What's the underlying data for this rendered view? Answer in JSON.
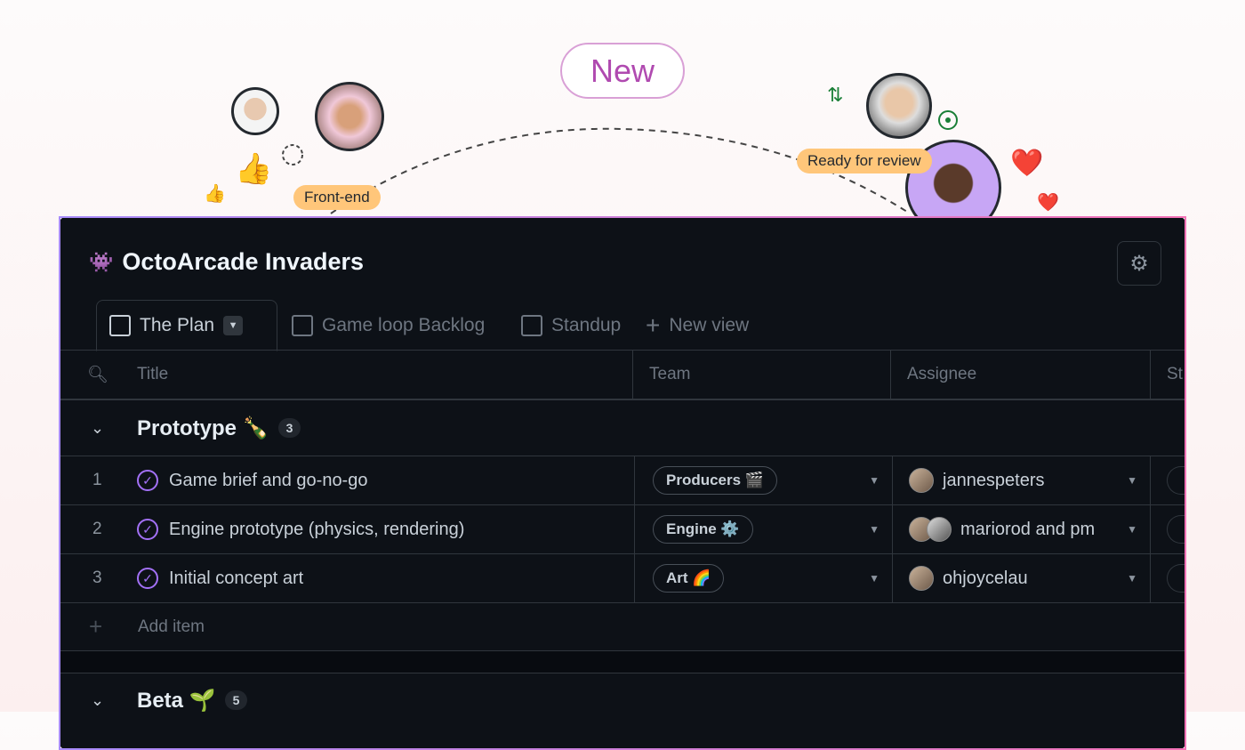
{
  "banner": {
    "new_label": "New",
    "tags": [
      "Front-end",
      "Ready for review"
    ]
  },
  "project": {
    "title": "OctoArcade Invaders",
    "icon": "👾"
  },
  "tabs": [
    {
      "label": "The Plan",
      "icon": "table-icon"
    },
    {
      "label": "Game loop Backlog",
      "icon": "table-icon"
    },
    {
      "label": "Standup",
      "icon": "board-icon"
    },
    {
      "label": "New view",
      "icon": "plus-icon"
    }
  ],
  "columns": [
    "Title",
    "Team",
    "Assignee",
    "St"
  ],
  "groups": [
    {
      "name": "Prototype 🍾",
      "count": "3",
      "items": [
        {
          "num": "1",
          "title": "Game brief and go-no-go",
          "team": "Producers 🎬",
          "assignee": "jannespeters"
        },
        {
          "num": "2",
          "title": "Engine prototype (physics, rendering)",
          "team": "Engine ⚙️",
          "assignee": "mariorod and pm"
        },
        {
          "num": "3",
          "title": "Initial concept art",
          "team": "Art 🌈",
          "assignee": "ohjoycelau"
        }
      ],
      "add_label": "Add item"
    },
    {
      "name": "Beta 🌱",
      "count": "5"
    }
  ],
  "colors": {
    "card_bg": "#0d1117",
    "accent": "#a371f7",
    "tag": "#ffc67a"
  }
}
